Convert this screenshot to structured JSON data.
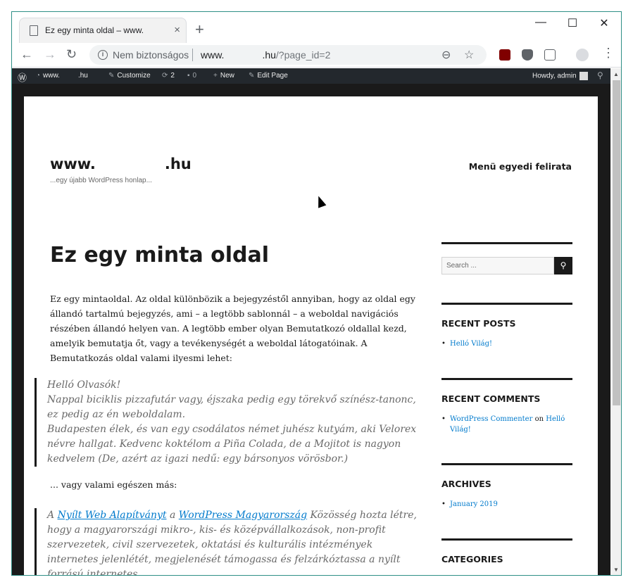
{
  "browser": {
    "tab_title": "Ez egy minta oldal – www.",
    "tab_close": "×",
    "new_tab": "+",
    "security_label": "Nem biztonságos",
    "url_prefix": "www.",
    "url_suffix": ".hu",
    "url_path": "/?page_id=2",
    "icons": [
      "back-icon",
      "forward-icon",
      "reload-icon",
      "info-icon",
      "zoom-out-icon",
      "star-icon",
      "ublock-icon",
      "pocket-icon",
      "reader-icon",
      "profile-icon",
      "menu-icon"
    ]
  },
  "adminbar": {
    "site_prefix": "www.",
    "site_suffix": ".hu",
    "customize": "Customize",
    "updates": "2",
    "comments": "0",
    "new": "New",
    "edit_page": "Edit Page",
    "howdy": "Howdy, admin"
  },
  "site": {
    "title_prefix": "www.",
    "title_suffix": ".hu",
    "description": "...egy újabb WordPress honlap...",
    "menu_item": "Menü egyedi felirata"
  },
  "entry": {
    "title": "Ez egy minta oldal",
    "paragraph1": "Ez egy mintaoldal. Az oldal különbözik a bejegyzéstől annyiban, hogy az oldal egy állandó tartalmú bejegyzés, ami – a legtöbb sablonnál – a weboldal navigációs részében állandó helyen van. A legtöbb ember olyan Bemutatkozó oldallal kezd, amelyik bemutatja őt, vagy a tevékenységét a weboldal látogatóinak. A Bemutatkozás oldal valami ilyesmi lehet:",
    "quote1_line1": "Helló Olvasók!",
    "quote1_line2": "Nappal biciklis pizzafutár vagy, éjszaka pedig egy törekvő színész-tanonc, ez pedig az én weboldalam.",
    "quote1_line3": "Budapesten élek, és van egy csodálatos német juhész kutyám, aki Velorex névre hallgat. Kedvenc koktélom a Piña Colada, de a Mojitot is nagyon kedvelem (De, azért az igazi nedű: egy bársonyos vörösbor.)",
    "paragraph2": "... vagy valami egészen más:",
    "quote2_a": "A ",
    "quote2_link1": "Nyílt Web Alapítványt",
    "quote2_b": " a ",
    "quote2_link2": "WordPress Magyarország",
    "quote2_c": " Közösség hozta létre, hogy a magyarországi mikro-, kis- és középvállalkozások, non-profit szervezetek, civil szervezetek, oktatási és kulturális intézmények internetes jelenlétét, megjelenését támogassa és felzárkóztassa a nyílt forrású internetes"
  },
  "sidebar": {
    "search_placeholder": "Search ...",
    "recent_posts_title": "Recent Posts",
    "recent_posts": [
      "Helló Világ!"
    ],
    "recent_comments_title": "Recent Comments",
    "comment_author": "WordPress Commenter",
    "comment_on": " on ",
    "comment_post": "Helló Világ!",
    "archives_title": "Archives",
    "archives": [
      "January 2019"
    ],
    "categories_title": "Categories"
  }
}
